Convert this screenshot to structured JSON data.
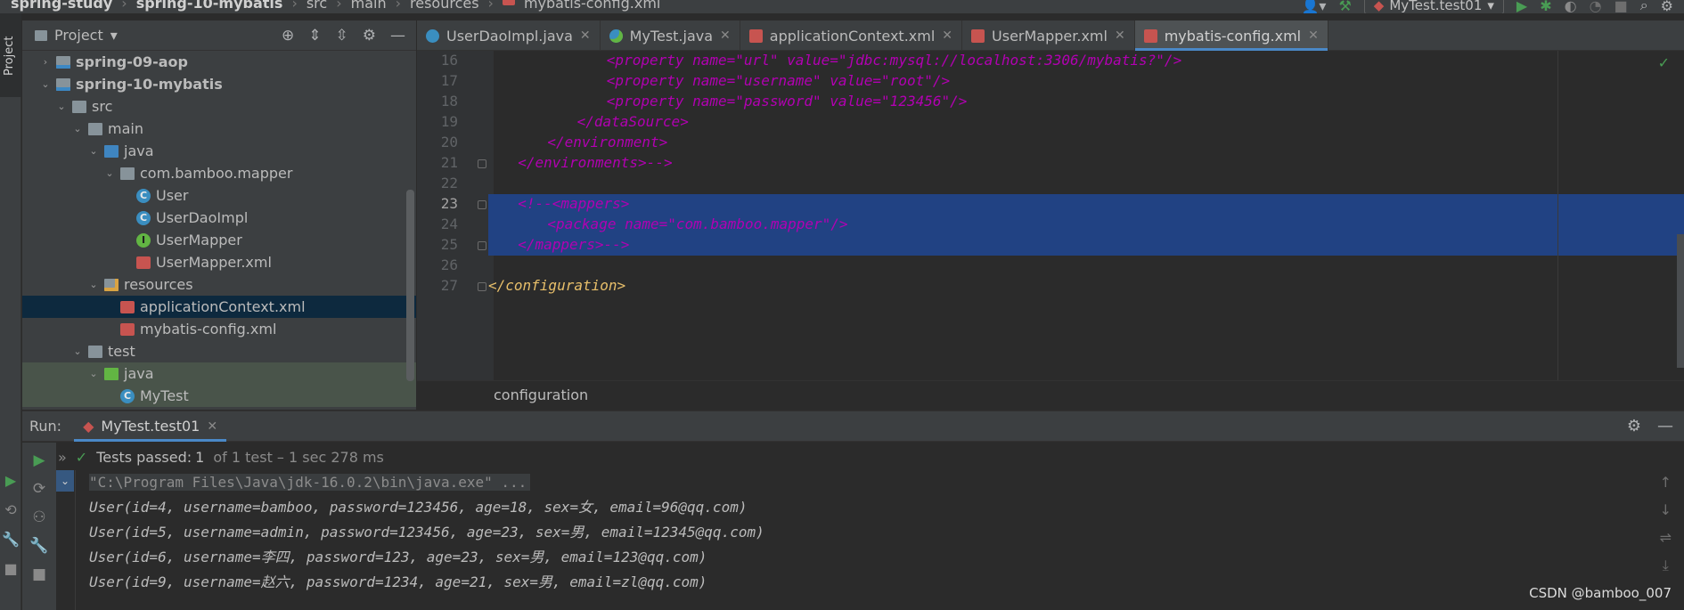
{
  "breadcrumb": [
    "spring-study",
    "spring-10-mybatis",
    "src",
    "main",
    "resources",
    "mybatis-config.xml"
  ],
  "run_config": "MyTest.test01",
  "side_tab": "Project",
  "project_panel": {
    "title": "Project",
    "tree": [
      {
        "label": "spring-09-aop",
        "icon": "module",
        "arrow": "›",
        "indent": 0,
        "bold": true
      },
      {
        "label": "spring-10-mybatis",
        "icon": "module",
        "arrow": "⌄",
        "indent": 0,
        "bold": true
      },
      {
        "label": "src",
        "icon": "folder",
        "arrow": "⌄",
        "indent": 1
      },
      {
        "label": "main",
        "icon": "folder",
        "arrow": "⌄",
        "indent": 2
      },
      {
        "label": "java",
        "icon": "src",
        "arrow": "⌄",
        "indent": 3
      },
      {
        "label": "com.bamboo.mapper",
        "icon": "pkg",
        "arrow": "⌄",
        "indent": 4
      },
      {
        "label": "User",
        "icon": "class",
        "arrow": "",
        "indent": 5
      },
      {
        "label": "UserDaoImpl",
        "icon": "class",
        "arrow": "",
        "indent": 5
      },
      {
        "label": "UserMapper",
        "icon": "iface",
        "arrow": "",
        "indent": 5
      },
      {
        "label": "UserMapper.xml",
        "icon": "xml",
        "arrow": "",
        "indent": 5
      },
      {
        "label": "resources",
        "icon": "res",
        "arrow": "⌄",
        "indent": 3
      },
      {
        "label": "applicationContext.xml",
        "icon": "xml",
        "arrow": "",
        "indent": 4,
        "selected": true
      },
      {
        "label": "mybatis-config.xml",
        "icon": "xml",
        "arrow": "",
        "indent": 4
      },
      {
        "label": "test",
        "icon": "folder",
        "arrow": "⌄",
        "indent": 2
      },
      {
        "label": "java",
        "icon": "test",
        "arrow": "⌄",
        "indent": 3,
        "testroot": true
      },
      {
        "label": "MyTest",
        "icon": "class",
        "arrow": "",
        "indent": 4,
        "testroot": true
      }
    ]
  },
  "editor": {
    "tabs": [
      {
        "label": "UserDaoImpl.java",
        "icon": "class",
        "active": false
      },
      {
        "label": "MyTest.java",
        "icon": "test",
        "active": false
      },
      {
        "label": "applicationContext.xml",
        "icon": "xml",
        "active": false
      },
      {
        "label": "UserMapper.xml",
        "icon": "xml",
        "active": false
      },
      {
        "label": "mybatis-config.xml",
        "icon": "xml",
        "active": true
      }
    ],
    "lines": [
      {
        "num": "16",
        "indent": 16,
        "style": "commented",
        "text": "<property name=\"url\" value=\"jdbc:mysql://localhost:3306/mybatis?\"/>"
      },
      {
        "num": "17",
        "indent": 16,
        "style": "commented",
        "text": "<property name=\"username\" value=\"root\"/>"
      },
      {
        "num": "18",
        "indent": 16,
        "style": "commented",
        "text": "<property name=\"password\" value=\"123456\"/>"
      },
      {
        "num": "19",
        "indent": 12,
        "style": "commented",
        "text": "</dataSource>"
      },
      {
        "num": "20",
        "indent": 8,
        "style": "commented",
        "text": "</environment>"
      },
      {
        "num": "21",
        "indent": 4,
        "style": "commented",
        "text": "</environments>-->"
      },
      {
        "num": "22",
        "indent": 0,
        "style": "plain",
        "text": ""
      },
      {
        "num": "23",
        "indent": 4,
        "style": "commented",
        "text": "<!--<mappers>",
        "selected": true,
        "current": true
      },
      {
        "num": "24",
        "indent": 8,
        "style": "commented",
        "text": "<package name=\"com.bamboo.mapper\"/>",
        "selected": true
      },
      {
        "num": "25",
        "indent": 4,
        "style": "commented",
        "text": "</mappers>-->",
        "selected": true
      },
      {
        "num": "26",
        "indent": 0,
        "style": "plain",
        "text": ""
      },
      {
        "num": "27",
        "indent": 0,
        "style": "tag",
        "text": "</configuration>"
      }
    ],
    "footer_breadcrumb": "configuration"
  },
  "run_panel": {
    "label": "Run:",
    "tab": "MyTest.test01",
    "status_prefix": "Tests passed:",
    "status_count": "1",
    "status_detail": "of 1 test – 1 sec 278 ms",
    "console_lines": [
      "\"C:\\Program Files\\Java\\jdk-16.0.2\\bin\\java.exe\" ...",
      "User(id=4, username=bamboo, password=123456, age=18, sex=女, email=96@qq.com)",
      "User(id=5, username=admin, password=123456, age=23, sex=男, email=12345@qq.com)",
      "User(id=6, username=李四, password=123, age=23, sex=男, email=123@qq.com)",
      "User(id=9, username=赵六, password=1234, age=21, sex=男, email=zl@qq.com)"
    ]
  },
  "watermark": "CSDN @bamboo_007",
  "colors": {
    "accent": "#4a88c7",
    "selection": "#214283",
    "comment": "#b200b2",
    "pass": "#499c54"
  }
}
